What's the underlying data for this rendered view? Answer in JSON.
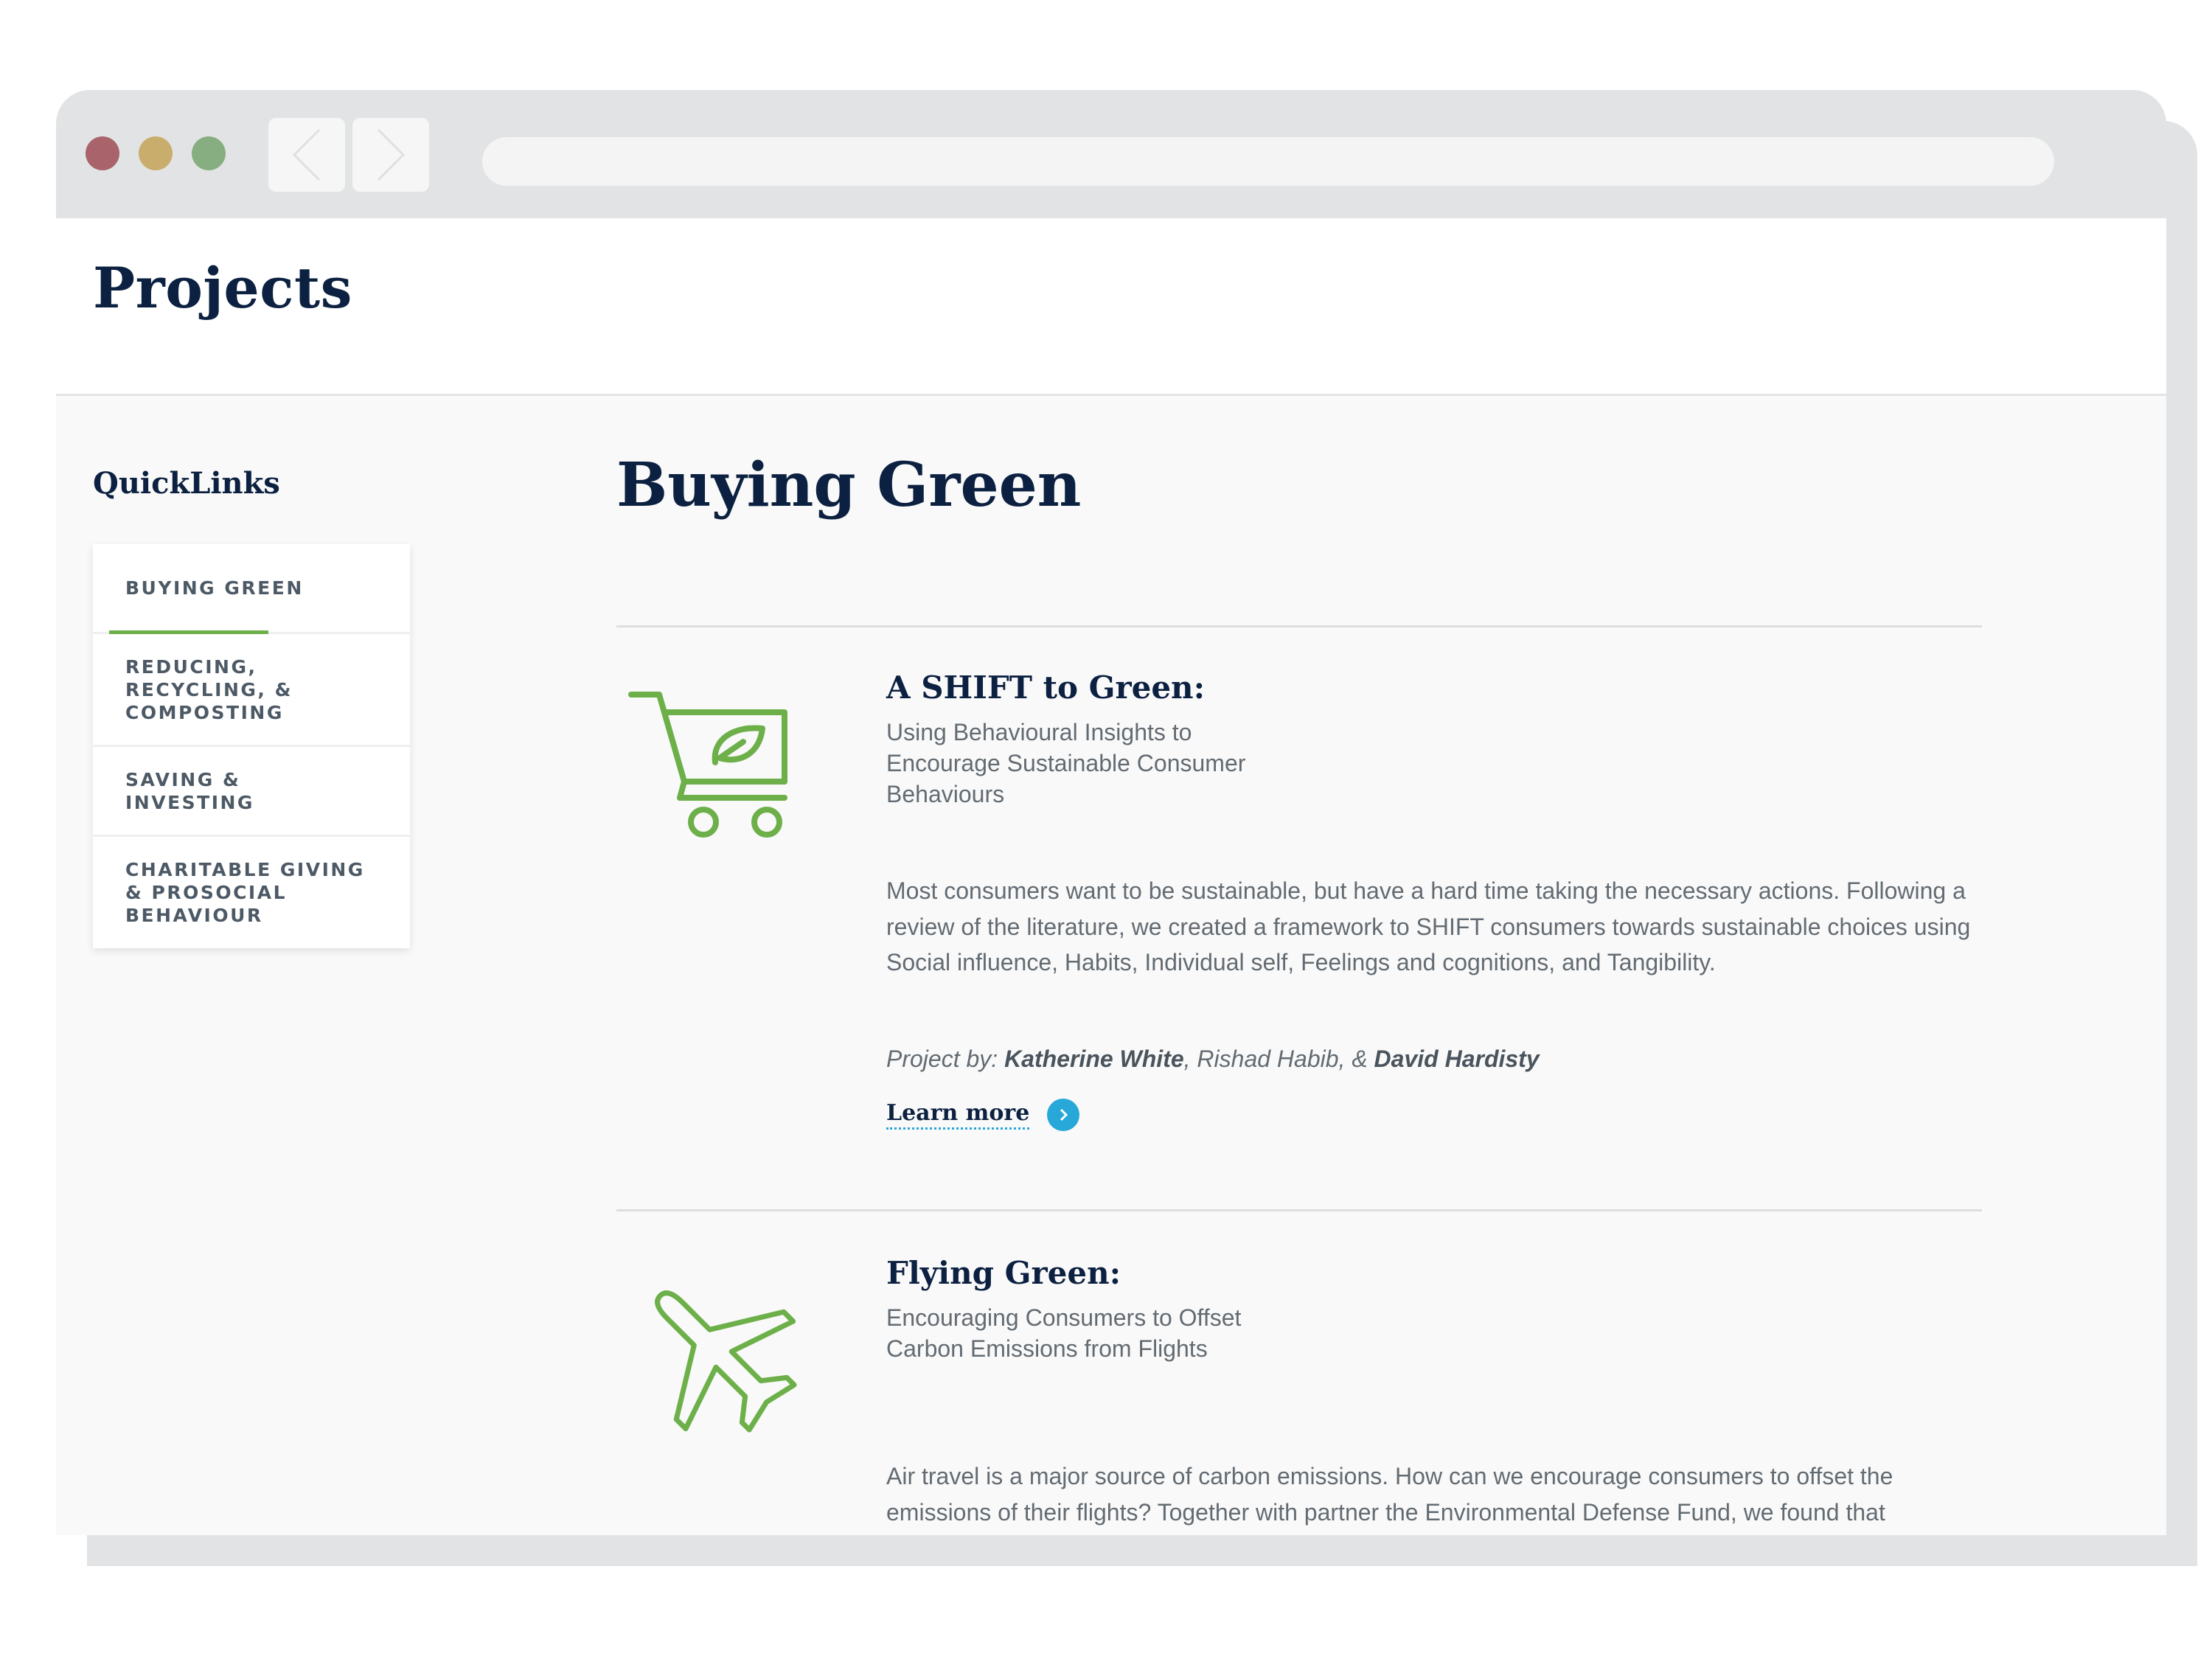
{
  "page": {
    "title": "Projects"
  },
  "quicklinks": {
    "heading": "QuickLinks",
    "items": [
      {
        "label": "BUYING GREEN",
        "active": true
      },
      {
        "label": "REDUCING, RECYCLING, & COMPOSTING",
        "active": false
      },
      {
        "label": "SAVING & INVESTING",
        "active": false
      },
      {
        "label": "CHARITABLE GIVING & PROSOCIAL BEHAVIOUR",
        "active": false
      }
    ]
  },
  "section": {
    "title": "Buying Green"
  },
  "projects": [
    {
      "icon": "shopping-cart-leaf-icon",
      "title": "A SHIFT to Green:",
      "subtitle": "Using Behavioural Insights to Encourage Sustainable Consumer Behaviours",
      "description": "Most consumers want to be sustainable, but have a hard time taking the necessary actions. Following a review of the literature, we created a framework to SHIFT consumers towards sustainable choices using Social influence, Habits, Individual self, Feelings and cognitions, and Tangibility.",
      "project_by_label": "Project by:",
      "author_1": "Katherine White",
      "author_sep_1": ", Rishad Habib, & ",
      "author_2": "David Hardisty",
      "learn_more": "Learn more"
    },
    {
      "icon": "airplane-icon",
      "title": "Flying Green:",
      "subtitle": "Encouraging Consumers to Offset Carbon Emissions from Flights",
      "description": "Air travel is a major source of carbon emissions. How can we encourage consumers to offset the emissions of their flights? Together with partner the Environmental Defense Fund, we found that consumers support carbon pricing more when it is described as a carbon offset for aviation fuel"
    }
  ],
  "colors": {
    "navy": "#0c2141",
    "accent_green": "#6db04a",
    "link_blue": "#27a8d8",
    "body_text": "#636b72"
  }
}
